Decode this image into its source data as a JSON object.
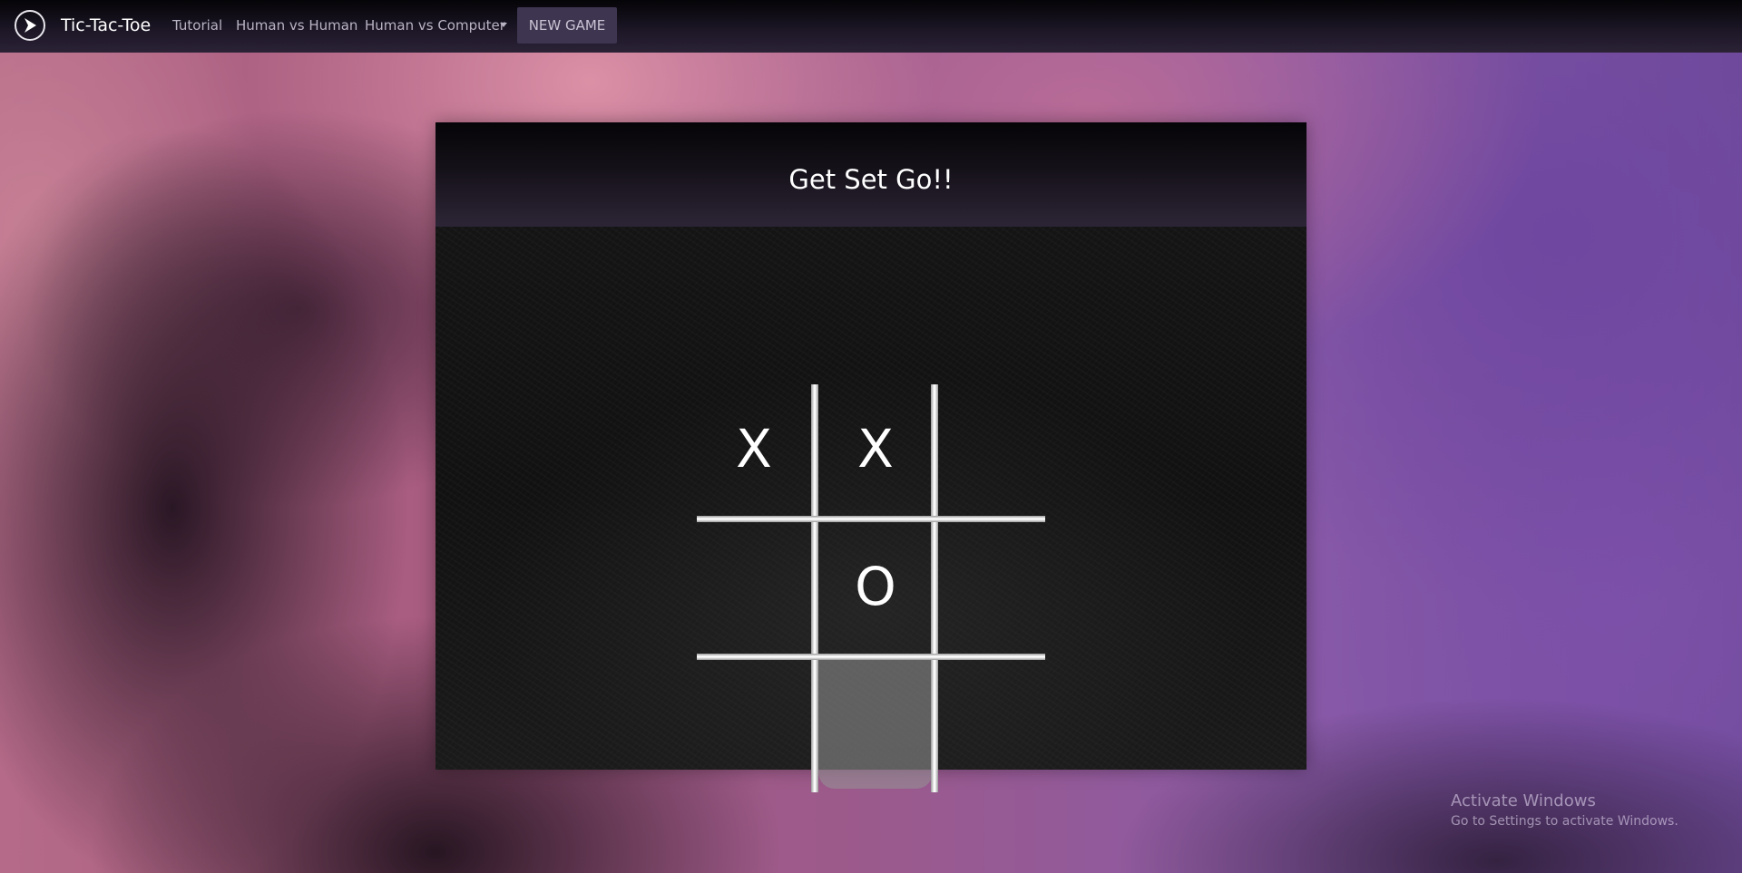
{
  "navbar": {
    "brand": "Tic-Tac-Toe",
    "links": {
      "tutorial": "Tutorial",
      "human_vs_human": "Human vs Human",
      "human_vs_computer": "Human vs Computer"
    },
    "new_game_label": "NEW GAME"
  },
  "game": {
    "title": "Get Set Go!!",
    "board": [
      [
        "X",
        "X",
        ""
      ],
      [
        "",
        "O",
        ""
      ],
      [
        "",
        "",
        ""
      ]
    ],
    "hovered_cell": "row 3, column 2"
  },
  "watermark": {
    "title": "Activate Windows",
    "subtitle": "Go to Settings to activate Windows."
  }
}
